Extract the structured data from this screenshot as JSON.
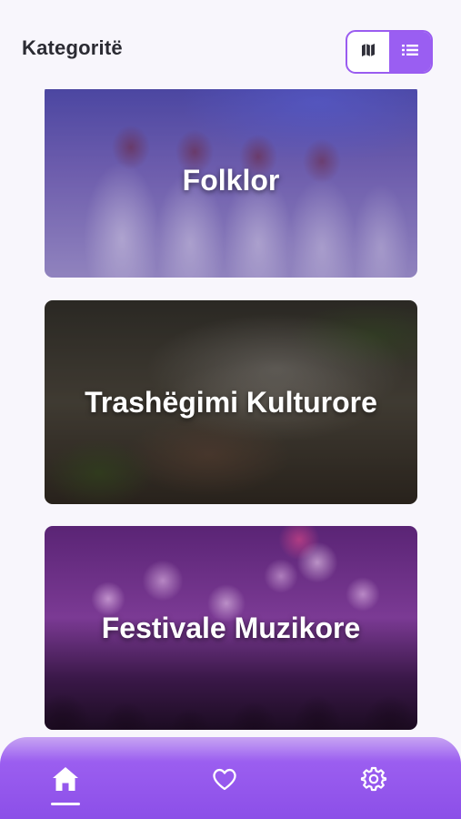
{
  "header": {
    "title": "Kategoritë",
    "view_toggle": {
      "options": [
        {
          "name": "map",
          "icon": "map-icon",
          "active": false
        },
        {
          "name": "list",
          "icon": "list-icon",
          "active": true
        }
      ]
    }
  },
  "categories": [
    {
      "label": "Folklor"
    },
    {
      "label": "Trashëgimi Kulturore"
    },
    {
      "label": "Festivale Muzikore"
    }
  ],
  "bottom_nav": {
    "items": [
      {
        "name": "home",
        "icon": "home-icon",
        "active": true
      },
      {
        "name": "favorites",
        "icon": "heart-icon",
        "active": false
      },
      {
        "name": "settings",
        "icon": "gear-icon",
        "active": false
      }
    ]
  },
  "colors": {
    "accent": "#9a5cf0",
    "nav_background": "#8c4fe8",
    "page_background": "#f8f6fc"
  }
}
